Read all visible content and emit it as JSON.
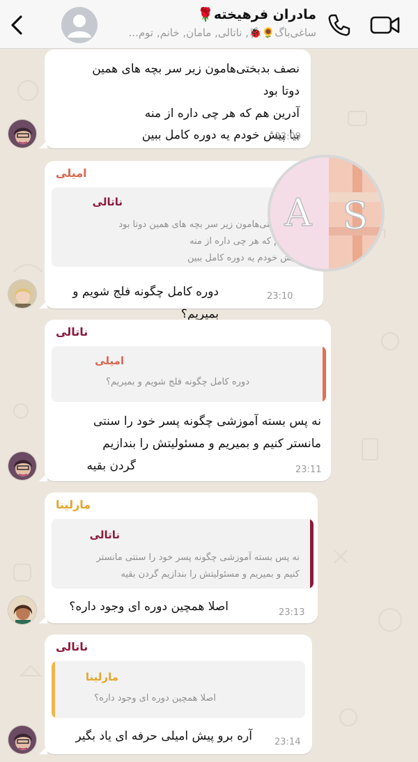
{
  "header": {
    "title": "مادران فرهیخته🌹",
    "members": "ساغی‌باگ🌻🐞, ناتالی, مامان, خانم, توم..."
  },
  "messages": [
    {
      "text_lines": [
        "نصف بدبختی‌هامون زیر سر بچه های همین",
        "دوتا بود",
        "آدرین هم که هر چی داره از منه",
        "بیا پیش خودم یه دوره کامل ببین"
      ],
      "time": "23:09"
    },
    {
      "sender": "امیلی",
      "sender_color": "#d9674f",
      "quote": {
        "name": "ناتالی",
        "name_color": "#8b1a3a",
        "lines": [
          "نصف بدبختی‌هامون زیر سر بچه های همین دوتا بود",
          "آدرین هم که هر چی داره از منه",
          "بیا پیش خودم یه دوره کامل ببین"
        ]
      },
      "text_lines": [
        "دوره کامل چگونه فلج شویم و بمیریم؟"
      ],
      "time": "23:10"
    },
    {
      "sender": "ناتالی",
      "sender_color": "#8b1a3a",
      "quote": {
        "name": "امیلی",
        "name_color": "#d9674f",
        "lines": [
          "دوره کامل چگونه فلج شویم و بمیریم؟"
        ]
      },
      "text_lines": [
        "نه پس بسته آموزشی چگونه پسر خود را سنتی",
        "مانستر کنیم و بمیریم و مسئولیتش را بندازیم",
        "گردن بقیه"
      ],
      "time": "23:11"
    },
    {
      "sender": "مارلینا",
      "sender_color": "#e5a52a",
      "quote": {
        "name": "ناتالی",
        "name_color": "#8b1a3a",
        "lines": [
          "نه پس بسته آموزشی چگونه پسر خود را سنتی مانستر",
          "کنیم و بمیریم و مسئولیتش را بندازیم گردن بقیه"
        ]
      },
      "text_lines": [
        "اصلا همچین دوره ای وجود داره؟"
      ],
      "time": "23:13"
    },
    {
      "sender": "ناتالی",
      "sender_color": "#8b1a3a",
      "quote": {
        "name": "مارلینا",
        "name_color": "#e5a52a",
        "lines": [
          "اصلا همچین دوره ای وجود داره؟"
        ]
      },
      "text_lines": [
        "آره برو پیش امیلی حرفه ای یاد بگیر"
      ],
      "time": "23:14"
    }
  ],
  "icons": {
    "back": "chevron-left-icon",
    "call": "phone-icon",
    "video": "video-camera-icon"
  }
}
